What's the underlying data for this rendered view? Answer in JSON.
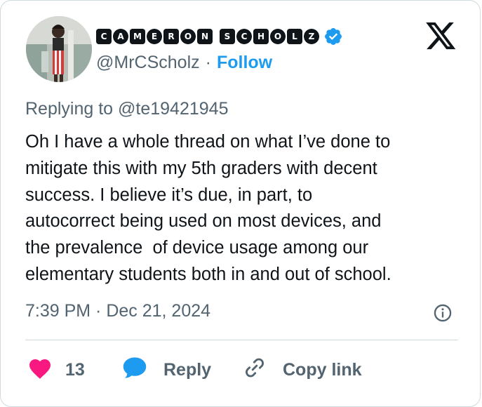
{
  "author": {
    "display_name_letters": [
      "C",
      "A",
      "M",
      "E",
      "R",
      "O",
      "N",
      " ",
      "S",
      "C",
      "H",
      "O",
      "L",
      "Z"
    ],
    "handle": "@MrCScholz",
    "separator": "·",
    "follow_label": "Follow",
    "verified": true
  },
  "tweet": {
    "replying_to": "Replying to @te19421945",
    "text": "Oh I have a whole thread on what I’ve done to\nmitigate this with my 5th graders with decent\nsuccess. I believe it’s due, in part, to\nautocorrect being used on most devices, and\nthe prevalence  of device usage among our\nelementary students both in and out of school.",
    "timestamp": "7:39 PM · Dec 21, 2024"
  },
  "actions": {
    "like_count": "13",
    "reply_label": "Reply",
    "copy_link_label": "Copy link"
  },
  "icons": {
    "brand": "x-logo-icon",
    "verified": "verified-badge-icon",
    "info": "info-icon",
    "like": "heart-icon",
    "reply": "speech-bubble-icon",
    "copy": "link-icon"
  },
  "colors": {
    "accent_blue": "#1d9bf0",
    "like_pink": "#f91880",
    "muted_text": "#536471",
    "primary_text": "#0f1419",
    "border": "#cfd9de"
  }
}
